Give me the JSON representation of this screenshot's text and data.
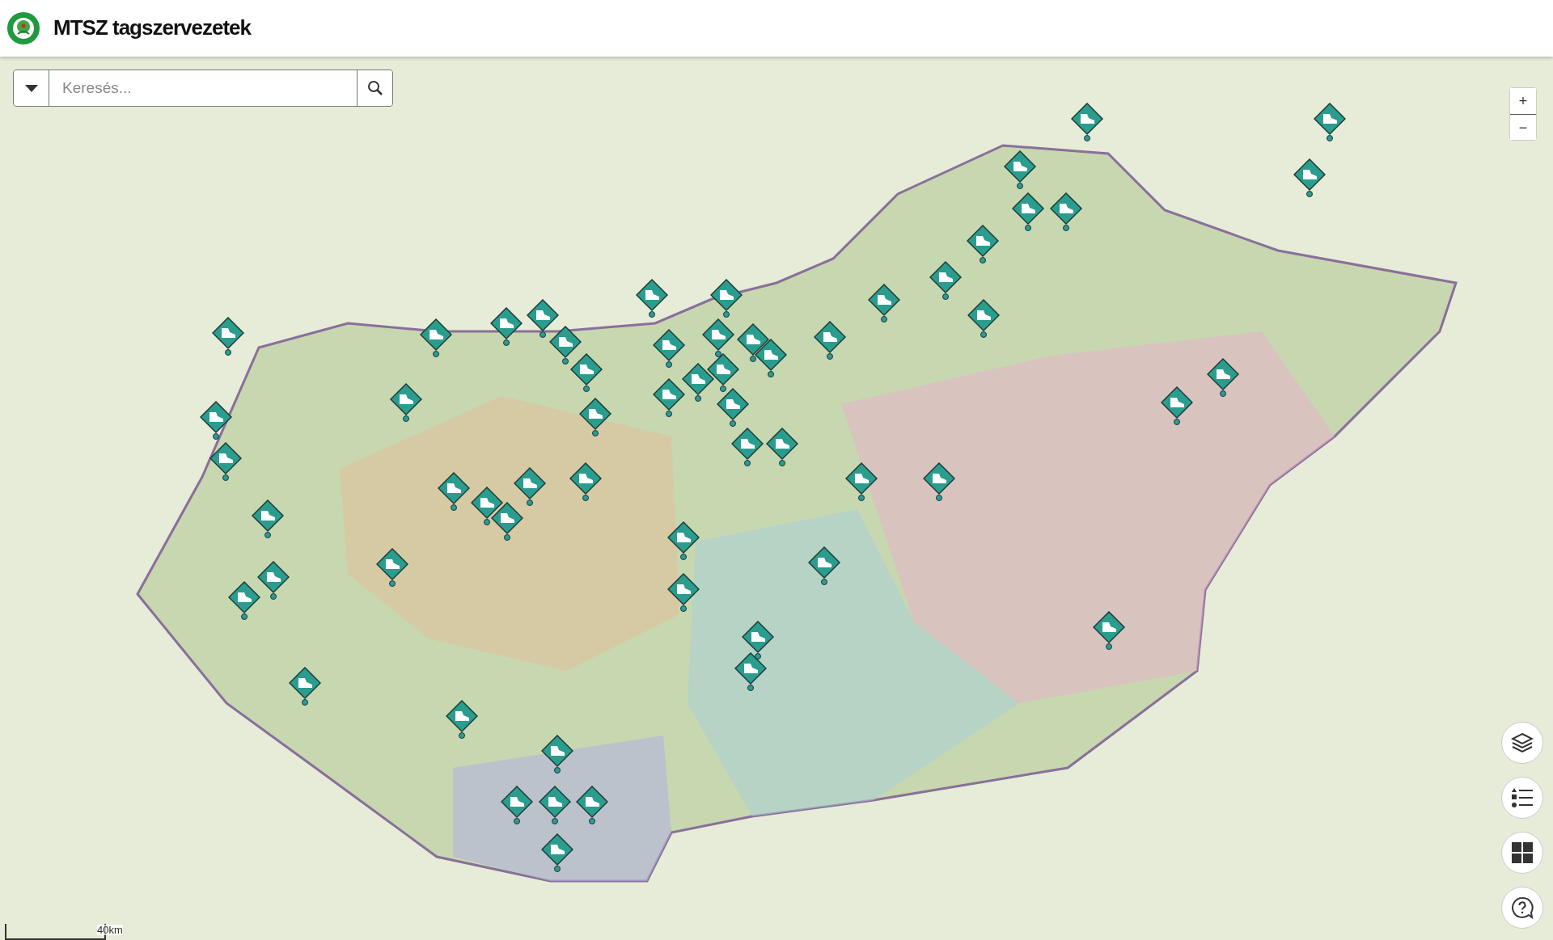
{
  "header": {
    "title": "MTSZ tagszervezetek"
  },
  "search": {
    "placeholder": "Keresés..."
  },
  "zoom": [
    "+",
    "−"
  ],
  "scale": {
    "label": "40km"
  }
}
